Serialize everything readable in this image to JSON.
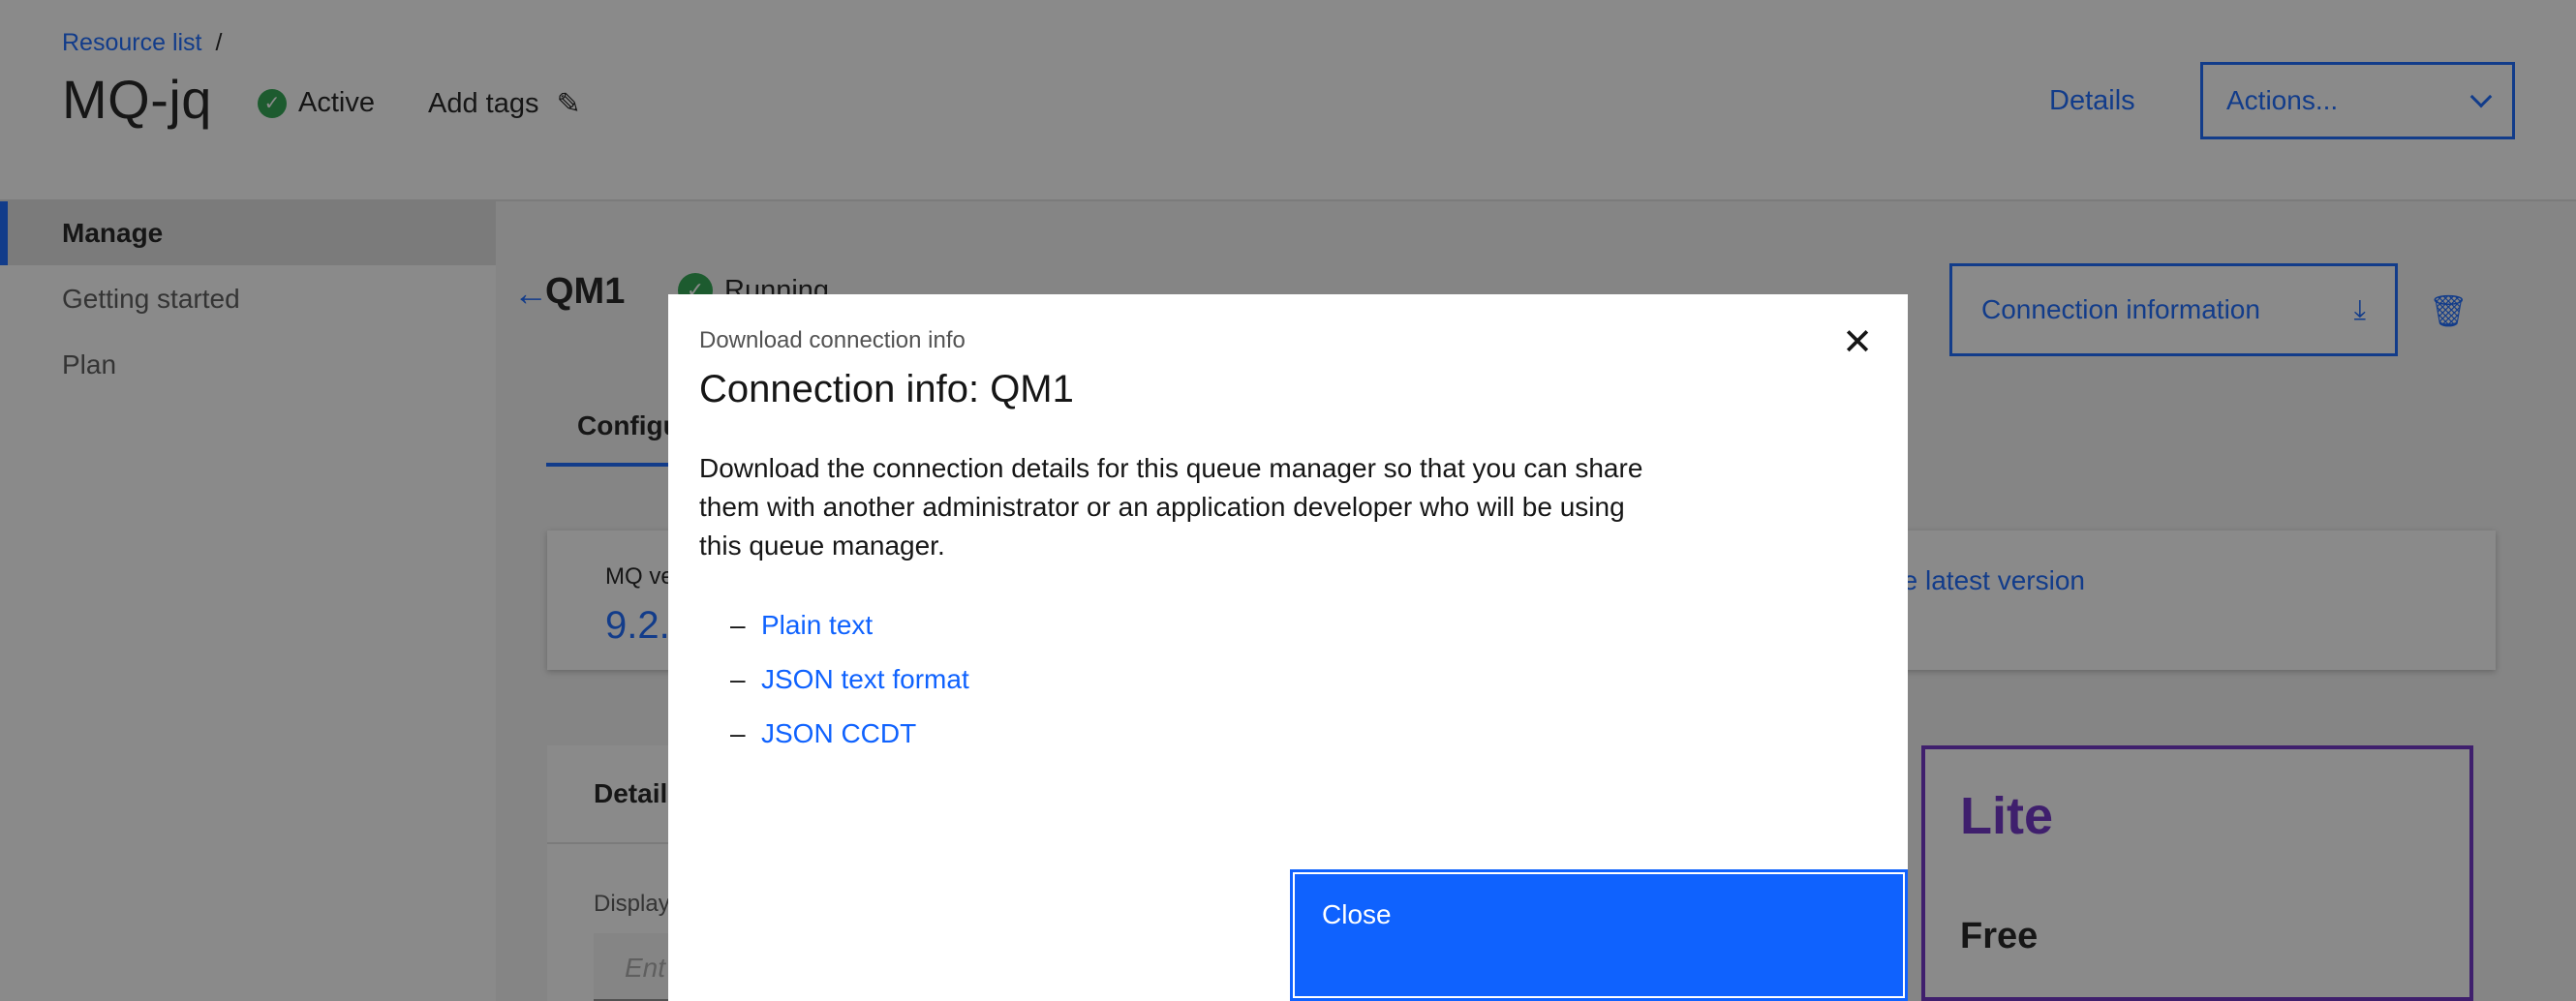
{
  "header": {
    "breadcrumb": "Resource list",
    "breadcrumb_sep": "/",
    "title": "MQ-jq",
    "status": "Active",
    "add_tags": "Add tags",
    "details": "Details",
    "actions": "Actions..."
  },
  "sidebar": {
    "items": [
      {
        "label": "Manage"
      },
      {
        "label": "Getting started"
      },
      {
        "label": "Plan"
      }
    ]
  },
  "main": {
    "qm_name": "QM1",
    "qm_status": "Running",
    "connection_info_button": "Connection information",
    "tab_config": "Configu",
    "version_label": "MQ ve",
    "version_value": "9.2.",
    "latest_text": "nning the latest version",
    "details_heading": "Detail",
    "display_label": "Display",
    "display_placeholder": "Ent",
    "plan_name": "Lite",
    "plan_price": "Free"
  },
  "modal": {
    "label": "Download connection info",
    "heading": "Connection info: QM1",
    "body": "Download the connection details for this queue manager so that you can share them with another administrator or an application developer who will be using this queue manager.",
    "links": [
      {
        "dash": "–",
        "label": "Plain text"
      },
      {
        "dash": "–",
        "label": "JSON text format"
      },
      {
        "dash": "–",
        "label": "JSON CCDT"
      }
    ],
    "close_button": "Close"
  },
  "colors": {
    "primary": "#0f62fe",
    "success": "#24a148",
    "plan_accent": "#6929c4",
    "overlay": "rgba(22,22,22,0.5)"
  },
  "icons": {
    "close": "close-icon",
    "download": "download-icon",
    "trash": "trash-icon",
    "edit": "pencil-icon",
    "back": "arrow-left-icon",
    "check": "checkmark-filled-icon",
    "chevron": "chevron-down-icon"
  }
}
